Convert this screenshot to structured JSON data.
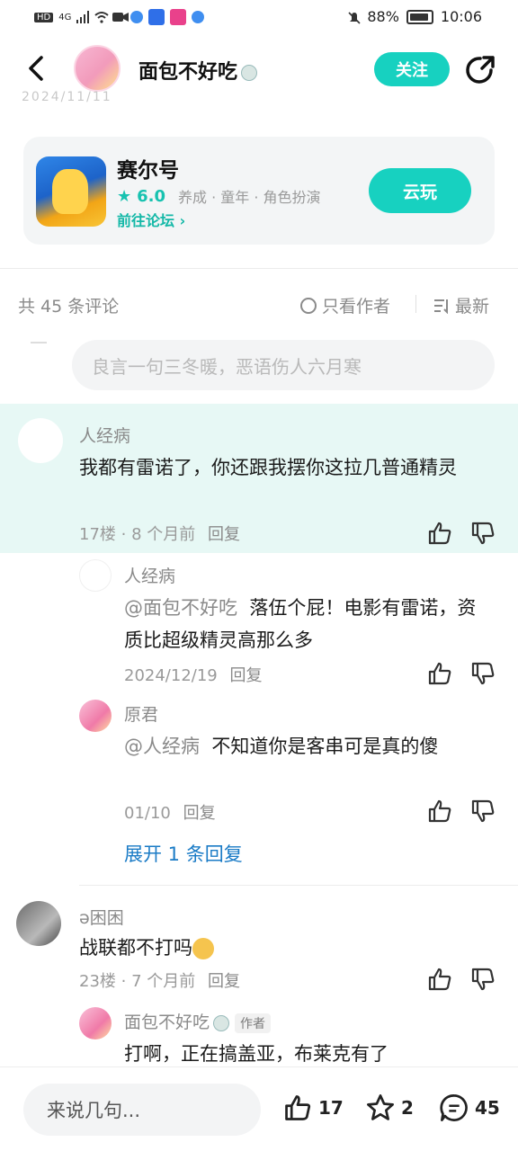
{
  "status_bar": {
    "left_labels": [
      "HD",
      "4G"
    ],
    "battery": "88%",
    "time": "10:06"
  },
  "header": {
    "username": "面包不好吃",
    "follow_label": "关注",
    "faded_date": "2024/11/11"
  },
  "game": {
    "name": "赛尔号",
    "rating": "6.0",
    "tags": "养成 · 童年 · 角色扮演",
    "forum_link": "前往论坛",
    "play_label": "云玩"
  },
  "comments_header": {
    "count": "共 45 条评论",
    "only_author": "只看作者",
    "sort": "最新"
  },
  "reply_placeholder": "良言一句三冬暖，恶语伤人六月寒",
  "comments": [
    {
      "name": "人经病",
      "text": "我都有雷诺了，你还跟我摆你这拉几普通精灵",
      "floor": "17楼 · 8 个月前",
      "reply": "回复"
    },
    {
      "name": "人经病",
      "mention": "@面包不好吃",
      "text": "落伍个屁！电影有雷诺，资质比超级精灵高那么多",
      "date": "2024/12/19",
      "reply": "回复"
    },
    {
      "name": "原君",
      "mention": "@人经病",
      "text": "不知道你是客串可是真的傻",
      "date": "01/10",
      "reply": "回复"
    },
    {
      "name": "ə困困",
      "text": "战联都不打吗",
      "floor": "23楼 · 7 个月前",
      "reply": "回复"
    },
    {
      "name": "面包不好吃",
      "author_tag": "作者",
      "text": "打啊，正在搞盖亚，布莱克有了"
    }
  ],
  "expand_label": "展开 1 条回复",
  "bottom_bar": {
    "say_placeholder": "来说几句...",
    "likes": "17",
    "favorites": "2",
    "comments": "45"
  }
}
